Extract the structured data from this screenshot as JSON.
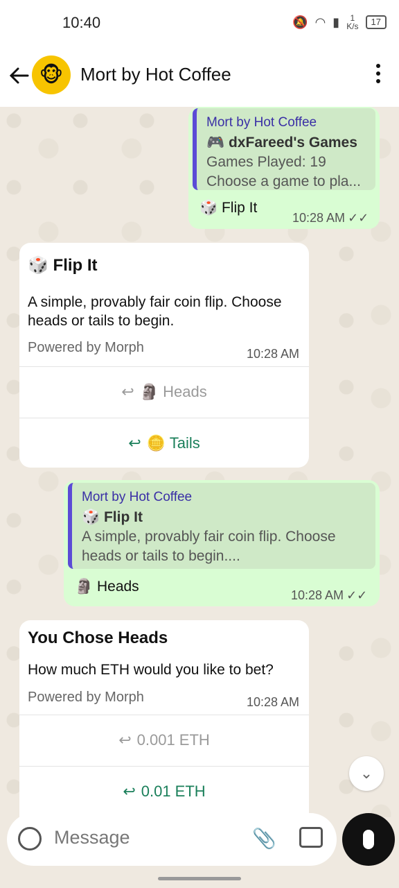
{
  "status": {
    "time": "10:40",
    "net": "1\nK/s",
    "battery": "17"
  },
  "header": {
    "title": "Mort by Hot Coffee",
    "avatar_icon": "monkey-icon"
  },
  "messages": {
    "m1": {
      "quote_author": "Mort by Hot Coffee",
      "quote_title": "🎮 dxFareed's Games",
      "quote_line1": "Games Played: 19",
      "quote_line2": "Choose a game to pla...",
      "text": "🎲 Flip It",
      "time": "10:28 AM"
    },
    "m2": {
      "title": "🎲 Flip It",
      "body": "A simple, provably fair coin flip. Choose heads or tails to begin.",
      "powered": "Powered by Morph",
      "time": "10:28 AM",
      "btn1": "🗿 Heads",
      "btn2": "🪙 Tails"
    },
    "m3": {
      "quote_author": "Mort by Hot Coffee",
      "quote_title": "🎲 Flip It",
      "quote_line1": "A simple, provably fair coin flip. Choose",
      "quote_line2": "heads or tails to begin....",
      "text": "🗿 Heads",
      "time": "10:28 AM"
    },
    "m4": {
      "title": "You Chose Heads",
      "body": "How much ETH would you like to bet?",
      "powered": "Powered by Morph",
      "time": "10:28 AM",
      "btn1": "0.001 ETH",
      "btn2": "0.01 ETH"
    }
  },
  "input": {
    "placeholder": "Message"
  },
  "colors": {
    "accent_green": "#1a7f5a",
    "quote_bar": "#5b4bd6",
    "outgoing": "#d9fdd3"
  }
}
